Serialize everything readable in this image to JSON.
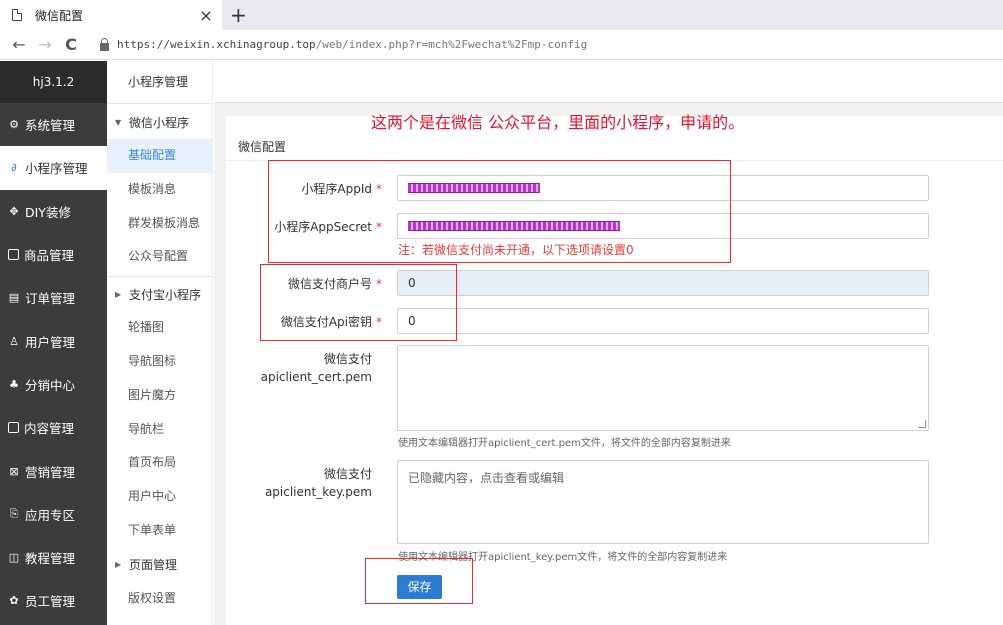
{
  "browser": {
    "tab_title": "微信配置",
    "tab_close": "×",
    "new_tab": "+",
    "back": "←",
    "forward": "→",
    "reload": "C",
    "url_host": "https://weixin.xchinagroup.top",
    "url_path": "/web/index.php?r=mch%2Fwechat%2Fmp-config"
  },
  "sidebar": {
    "brand": "hj3.1.2",
    "items": [
      {
        "label": "系统管理",
        "icon": "gear-icon"
      },
      {
        "label": "小程序管理",
        "icon": "link-icon"
      },
      {
        "label": "DIY装修",
        "icon": "paint-icon"
      },
      {
        "label": "商品管理",
        "icon": "goods-icon"
      },
      {
        "label": "订单管理",
        "icon": "order-icon"
      },
      {
        "label": "用户管理",
        "icon": "user-icon"
      },
      {
        "label": "分销中心",
        "icon": "network-icon"
      },
      {
        "label": "内容管理",
        "icon": "content-icon"
      },
      {
        "label": "营销管理",
        "icon": "marketing-icon"
      },
      {
        "label": "应用专区",
        "icon": "app-icon"
      },
      {
        "label": "教程管理",
        "icon": "book-icon"
      },
      {
        "label": "员工管理",
        "icon": "staff-icon"
      }
    ]
  },
  "subnav": {
    "head": "小程序管理",
    "group_wechat": "微信小程序",
    "wechat_items": [
      "基础配置",
      "模板消息",
      "群发模板消息",
      "公众号配置"
    ],
    "group_alipay": "支付宝小程序",
    "other_items": [
      "轮播图",
      "导航图标",
      "图片魔方",
      "导航栏",
      "首页布局",
      "用户中心",
      "下单表单"
    ],
    "group_page": "页面管理",
    "last_item": "版权设置"
  },
  "annotation": "这两个是在微信  公众平台，里面的小程序，申请的。",
  "form": {
    "card_title": "微信配置",
    "required_mark": "*",
    "appid_label": "小程序AppId",
    "appsecret_label": "小程序AppSecret",
    "warning": "注：若微信支付尚未开通，以下选项请设置0",
    "mchid_label": "微信支付商户号",
    "mchid_value": "0",
    "apikey_label": "微信支付Api密钥",
    "apikey_value": "0",
    "cert_label_1": "微信支付",
    "cert_label_2": "apiclient_cert.pem",
    "cert_hint": "使用文本编辑器打开apiclient_cert.pem文件，将文件的全部内容复制进来",
    "key_label_1": "微信支付",
    "key_label_2": "apiclient_key.pem",
    "key_value": "已隐藏内容，点击查看或编辑",
    "key_hint": "使用文本编辑器打开apiclient_key.pem文件，将文件的全部内容复制进来",
    "save": "保存"
  },
  "colors": {
    "sidebar_bg": "#3c3c3c",
    "accent": "#2e7bd6",
    "required": "#e4393c",
    "annotation": "#e8112d"
  }
}
